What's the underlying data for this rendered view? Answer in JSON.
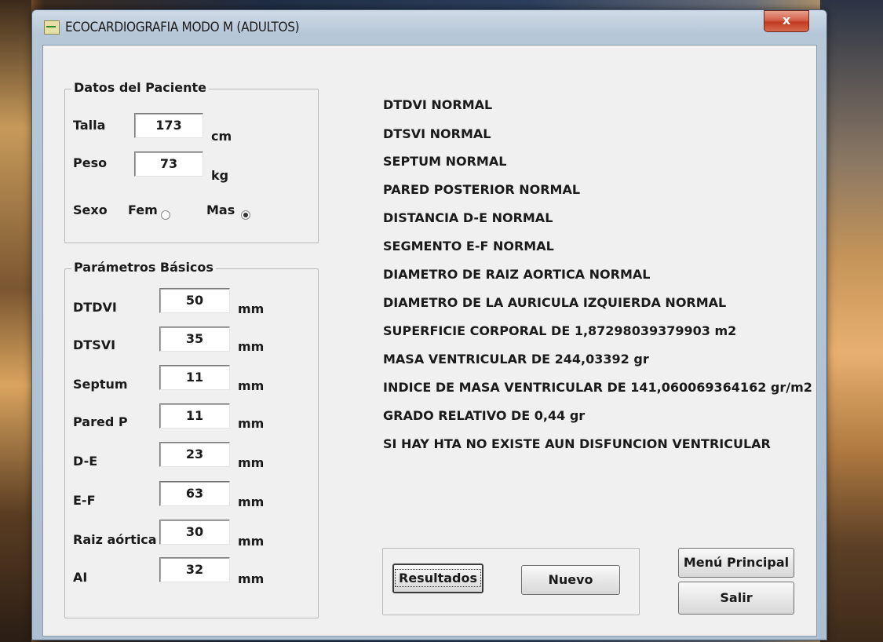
{
  "window": {
    "title": "ECOCARDIOGRAFIA MODO M (ADULTOS)",
    "close_label": "x"
  },
  "patient": {
    "group_title": "Datos del Paciente",
    "height_label": "Talla",
    "height_value": "173",
    "height_unit": "cm",
    "weight_label": "Peso",
    "weight_value": "73",
    "weight_unit": "kg",
    "sex_label": "Sexo",
    "sex_fem_label": "Fem",
    "sex_mas_label": "Mas",
    "sex_selected": "Mas"
  },
  "params": {
    "group_title": "Parámetros Básicos",
    "items": [
      {
        "label": "DTDVI",
        "value": "50",
        "unit": "mm"
      },
      {
        "label": "DTSVI",
        "value": "35",
        "unit": "mm"
      },
      {
        "label": "Septum",
        "value": "11",
        "unit": "mm"
      },
      {
        "label": "Pared P",
        "value": "11",
        "unit": "mm"
      },
      {
        "label": "D-E",
        "value": "23",
        "unit": "mm"
      },
      {
        "label": "E-F",
        "value": "63",
        "unit": "mm"
      },
      {
        "label": "Raiz aórtica",
        "value": "30",
        "unit": "mm"
      },
      {
        "label": "AI",
        "value": "32",
        "unit": "mm"
      }
    ]
  },
  "results": [
    "DTDVI NORMAL",
    "DTSVI NORMAL",
    "SEPTUM NORMAL",
    "PARED POSTERIOR NORMAL",
    "DISTANCIA D-E NORMAL",
    "SEGMENTO E-F NORMAL",
    "DIAMETRO DE RAIZ AORTICA NORMAL",
    "DIAMETRO DE LA AURICULA IZQUIERDA NORMAL",
    "SUPERFICIE CORPORAL DE 1,87298039379903 m2",
    "MASA VENTRICULAR DE 244,03392 gr",
    "INDICE DE MASA VENTRICULAR DE 141,060069364162 gr/m2",
    "GRADO RELATIVO DE  0,44 gr",
    "SI HAY HTA NO EXISTE AUN DISFUNCION VENTRICULAR"
  ],
  "buttons": {
    "results": "Resultados",
    "new": "Nuevo",
    "main_menu": "Menú Principal",
    "exit": "Salir"
  }
}
